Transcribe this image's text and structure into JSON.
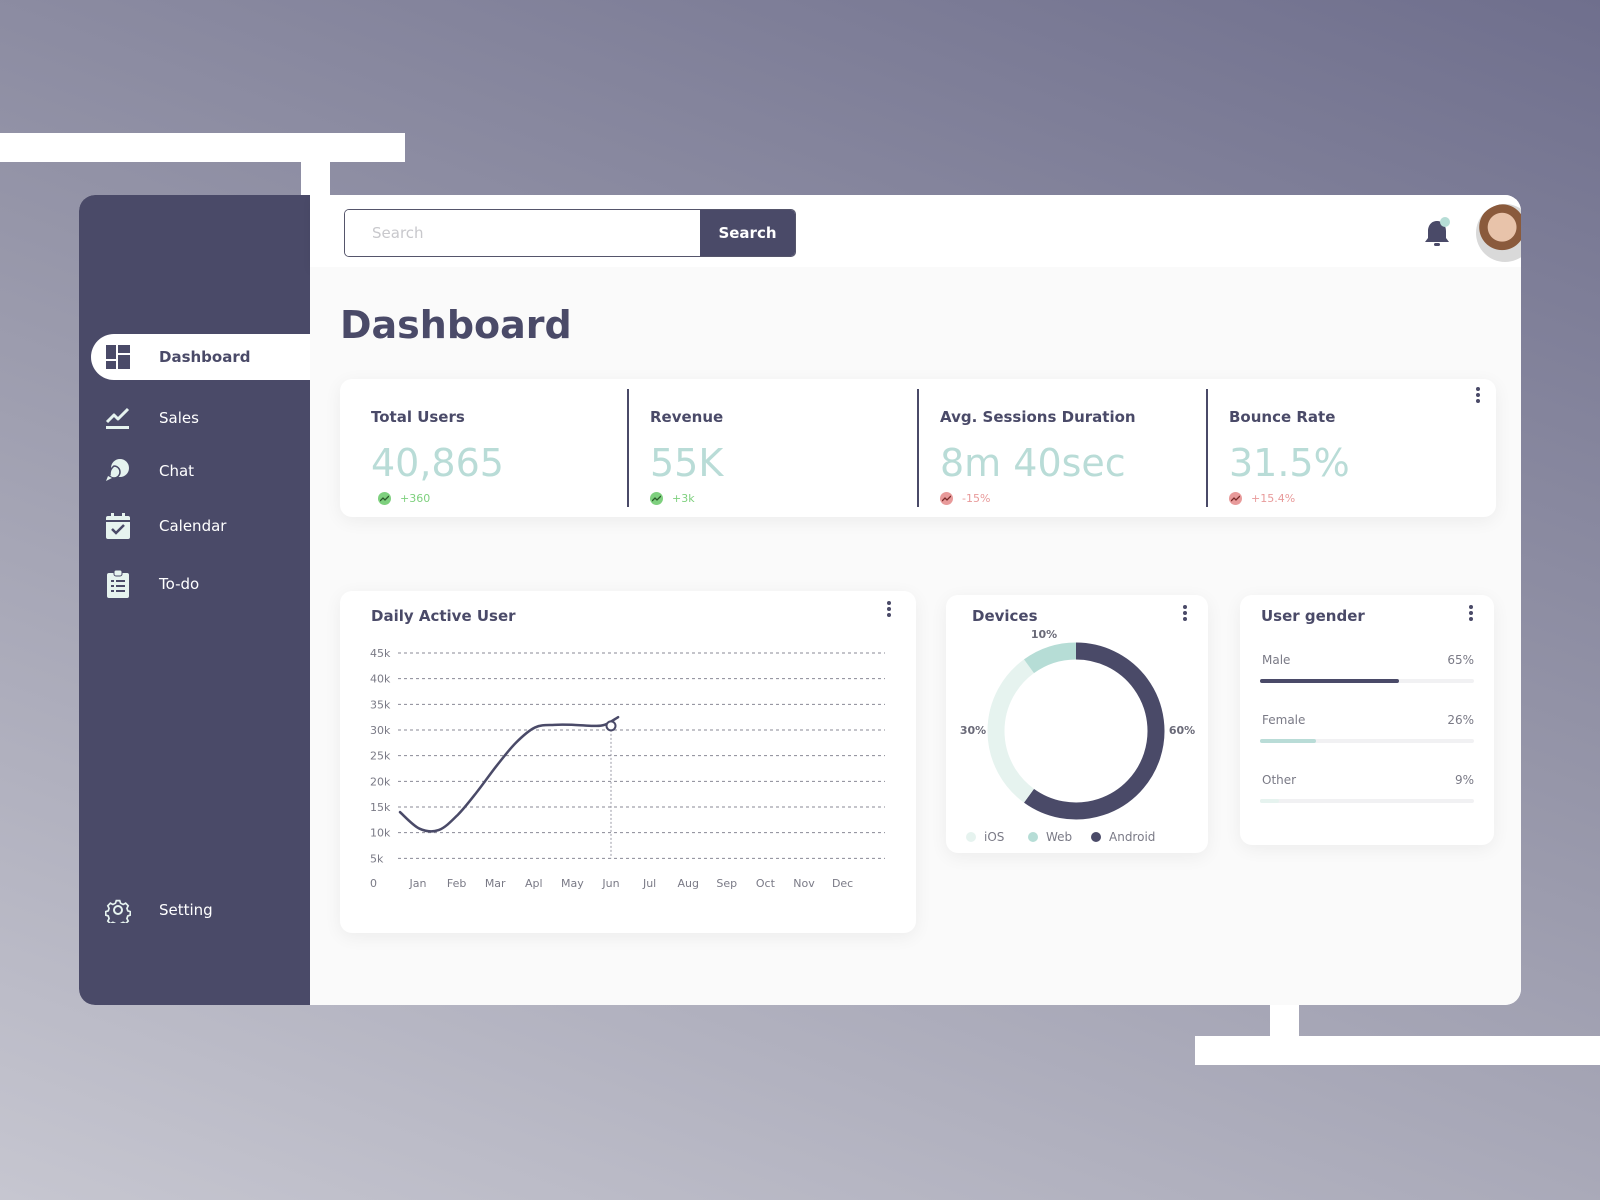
{
  "search": {
    "placeholder": "Search",
    "button_label": "Search"
  },
  "header": {
    "notification_dot_color": "#b6ddd6"
  },
  "sidebar": {
    "items": [
      {
        "label": "Dashboard",
        "icon": "dashboard-icon",
        "active": true
      },
      {
        "label": "Sales",
        "icon": "chart-line-icon",
        "active": false
      },
      {
        "label": "Chat",
        "icon": "chat-bubbles-icon",
        "active": false
      },
      {
        "label": "Calendar",
        "icon": "calendar-check-icon",
        "active": false
      },
      {
        "label": "To-do",
        "icon": "clipboard-list-icon",
        "active": false
      }
    ],
    "footer": {
      "label": "Setting",
      "icon": "gear-icon"
    }
  },
  "page": {
    "title": "Dashboard"
  },
  "stats": [
    {
      "title": "Total Users",
      "value": "40,865",
      "delta": "+360",
      "trend": "up"
    },
    {
      "title": "Revenue",
      "value": "55K",
      "delta": "+3k",
      "trend": "up"
    },
    {
      "title": "Avg. Sessions Duration",
      "value": "8m 40sec",
      "delta": "-15%",
      "trend": "down"
    },
    {
      "title": "Bounce Rate",
      "value": "31.5%",
      "delta": "+15.4%",
      "trend": "down"
    }
  ],
  "colors": {
    "primary": "#4a4a68",
    "value_teal": "#b9dcd7",
    "up": "#7ed07e",
    "down": "#e89a9a",
    "web": "#b6ddd6",
    "ios": "#e6f3ef"
  },
  "chart_data": [
    {
      "type": "line",
      "title": "Daily Active User",
      "categories": [
        "Jan",
        "Feb",
        "Mar",
        "Apl",
        "May",
        "Jun",
        "Jul",
        "Aug",
        "Sep",
        "Oct",
        "Nov",
        "Dec"
      ],
      "y_ticks": [
        "0",
        "5k",
        "10k",
        "15k",
        "20k",
        "25k",
        "30k",
        "35k",
        "40k",
        "45k"
      ],
      "ylim": [
        0,
        45000
      ],
      "series": [
        {
          "name": "Daily Active User",
          "x": [
            0.0,
            0.5,
            1.0,
            1.5,
            2.0,
            2.5,
            3.0,
            3.5,
            4.0,
            4.5,
            5.0,
            5.3,
            5.65
          ],
          "values": [
            14000,
            10800,
            10500,
            13500,
            18000,
            23000,
            27500,
            30500,
            31000,
            31000,
            30800,
            31000,
            32500
          ]
        }
      ],
      "highlight": {
        "category": "Jun",
        "value": 30800
      },
      "grid": true
    },
    {
      "type": "pie",
      "title": "Devices",
      "donut": true,
      "slices": [
        {
          "label": "Android",
          "value": 60,
          "color": "#4a4a68"
        },
        {
          "label": "iOS",
          "value": 30,
          "color": "#e6f3ef"
        },
        {
          "label": "Web",
          "value": 10,
          "color": "#b6ddd6"
        }
      ],
      "legend": [
        "iOS",
        "Web",
        "Android"
      ],
      "legend_position": "bottom"
    },
    {
      "type": "bar",
      "title": "User gender",
      "orientation": "horizontal",
      "categories": [
        "Male",
        "Female",
        "Other"
      ],
      "values": [
        65,
        26,
        9
      ],
      "labels": [
        "65%",
        "26%",
        "9%"
      ],
      "colors": [
        "#4a4a68",
        "#b9dcd7",
        "#e6f3ef"
      ]
    }
  ]
}
